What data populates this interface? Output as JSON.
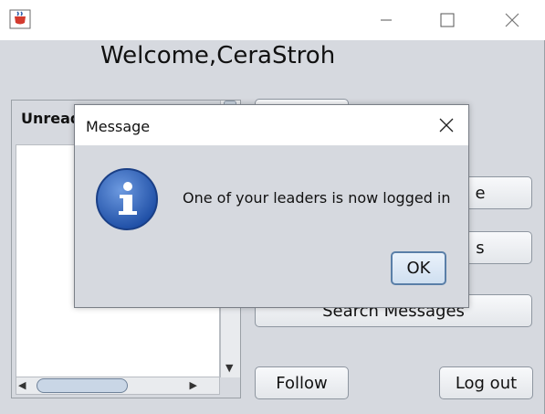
{
  "window": {
    "welcome": "Welcome,CeraStroh"
  },
  "panel": {
    "title": "Unread"
  },
  "buttons": {
    "top": "",
    "one": "e",
    "two": "s",
    "search": "Search Messages",
    "follow": "Follow",
    "logout": "Log out"
  },
  "dialog": {
    "title": "Message",
    "message": "One of your leaders is now logged in",
    "ok": "OK"
  },
  "icons": {
    "app": "java-cup-icon",
    "info": "info-icon"
  }
}
